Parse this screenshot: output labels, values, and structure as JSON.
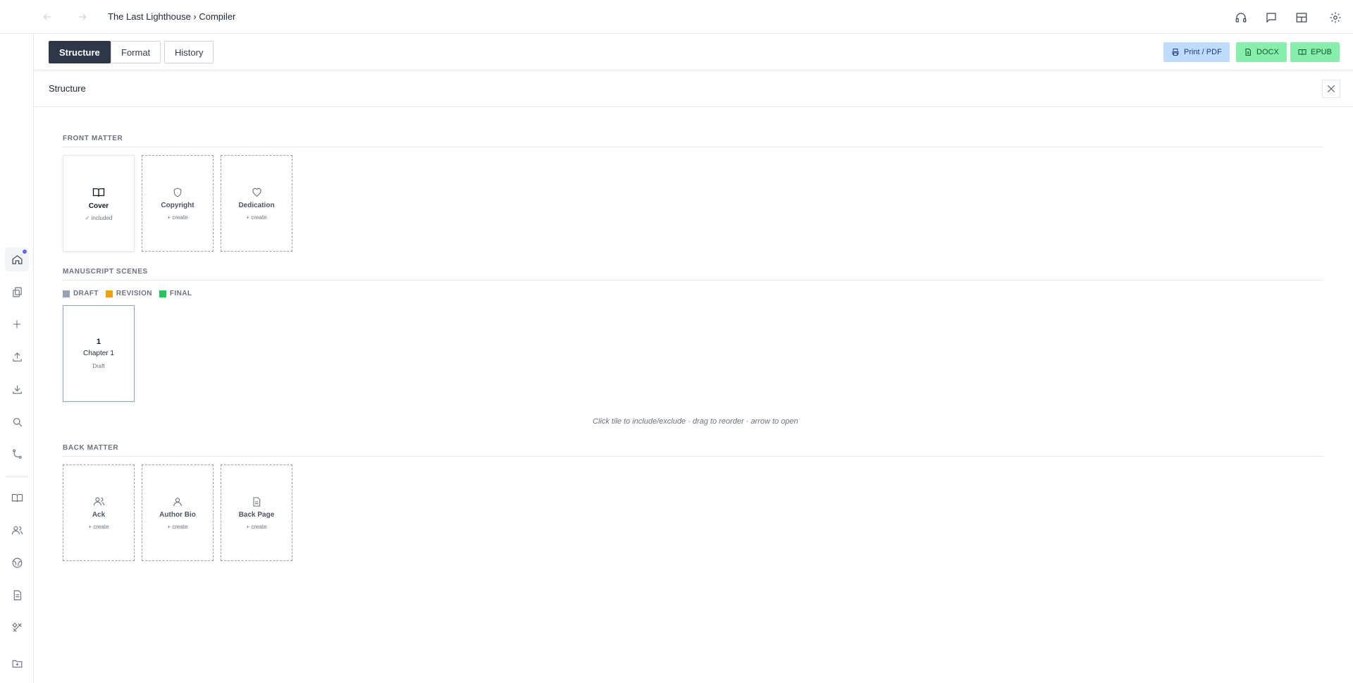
{
  "breadcrumb": "The Last Lighthouse › Compiler",
  "top_icons": [
    "headphones-icon",
    "comment-icon",
    "layout-icon",
    "gear-icon"
  ],
  "rail": {
    "items": [
      "home-icon",
      "copy-icon",
      "plus-icon",
      "upload-icon",
      "download-icon",
      "search-icon",
      "branch-icon",
      "book-icon",
      "users-icon",
      "globe-icon",
      "document-icon",
      "tools-icon",
      "folder-plus-icon"
    ],
    "active": "home-icon",
    "notification_color": "#6366f1"
  },
  "tabs": [
    "Structure",
    "Format",
    "History"
  ],
  "active_tab": "Structure",
  "exports": {
    "pdf": "Print / PDF",
    "docx": "DOCX",
    "epub": "EPUB"
  },
  "panel": {
    "title": "Structure"
  },
  "front_matter": {
    "label": "FRONT MATTER",
    "tiles": [
      {
        "name": "Cover",
        "status": "✓ included",
        "icon": "book-open-icon",
        "included": true
      },
      {
        "name": "Copyright",
        "status": "+ create",
        "icon": "shield-icon",
        "included": false
      },
      {
        "name": "Dedication",
        "status": "+ create",
        "icon": "heart-icon",
        "included": false
      }
    ]
  },
  "manuscript": {
    "label": "MANUSCRIPT SCENES",
    "legend": [
      {
        "label": "DRAFT",
        "color": "#94a3b8"
      },
      {
        "label": "REVISION",
        "color": "#f59e0b"
      },
      {
        "label": "FINAL",
        "color": "#22c55e"
      }
    ],
    "scenes": [
      {
        "number": "1",
        "name": "Chapter 1",
        "status": "Draft"
      }
    ],
    "hint": "Click tile to include/exclude · drag to reorder · arrow to open"
  },
  "back_matter": {
    "label": "BACK MATTER",
    "tiles": [
      {
        "name": "Ack",
        "status": "+ create",
        "icon": "users-icon"
      },
      {
        "name": "Author Bio",
        "status": "+ create",
        "icon": "user-icon"
      },
      {
        "name": "Back Page",
        "status": "+ create",
        "icon": "file-icon"
      }
    ]
  }
}
